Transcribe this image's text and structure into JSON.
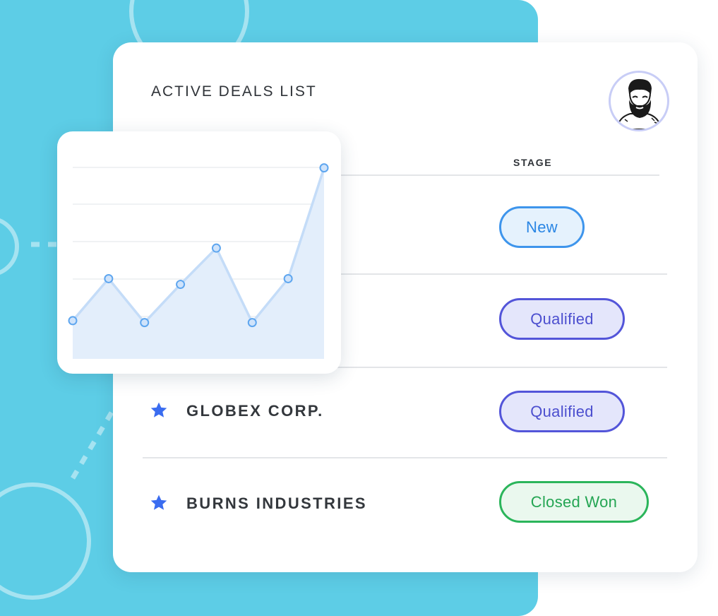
{
  "card": {
    "title": "ACTIVE DEALS LIST",
    "stage_header": "STAGE"
  },
  "deals": [
    {
      "company": "",
      "stage": "New",
      "starred": false
    },
    {
      "company": "",
      "stage": "Qualified",
      "starred": false
    },
    {
      "company": "GLOBEX CORP.",
      "stage": "Qualified",
      "starred": true
    },
    {
      "company": "BURNS INDUSTRIES",
      "stage": "Closed Won",
      "starred": true
    }
  ],
  "icons": {
    "avatar": "bearded-man-avatar",
    "star": "star-icon"
  },
  "colors": {
    "background": "#5dcde6",
    "star": "#3a6cf0",
    "new": "#3e95ec",
    "qualified": "#5355d9",
    "closed_won": "#2bb55b",
    "chart_line": "#c4dcf8",
    "chart_fill": "#e3eefb",
    "chart_point": "#5ea6ef"
  },
  "chart_data": {
    "type": "area",
    "x": [
      1,
      2,
      3,
      4,
      5,
      6,
      7,
      8
    ],
    "values": [
      1.0,
      2.1,
      0.95,
      1.95,
      2.9,
      0.95,
      2.1,
      5.0
    ],
    "ylim": [
      0,
      5.4
    ],
    "grid": true,
    "title": "",
    "xlabel": "",
    "ylabel": ""
  }
}
